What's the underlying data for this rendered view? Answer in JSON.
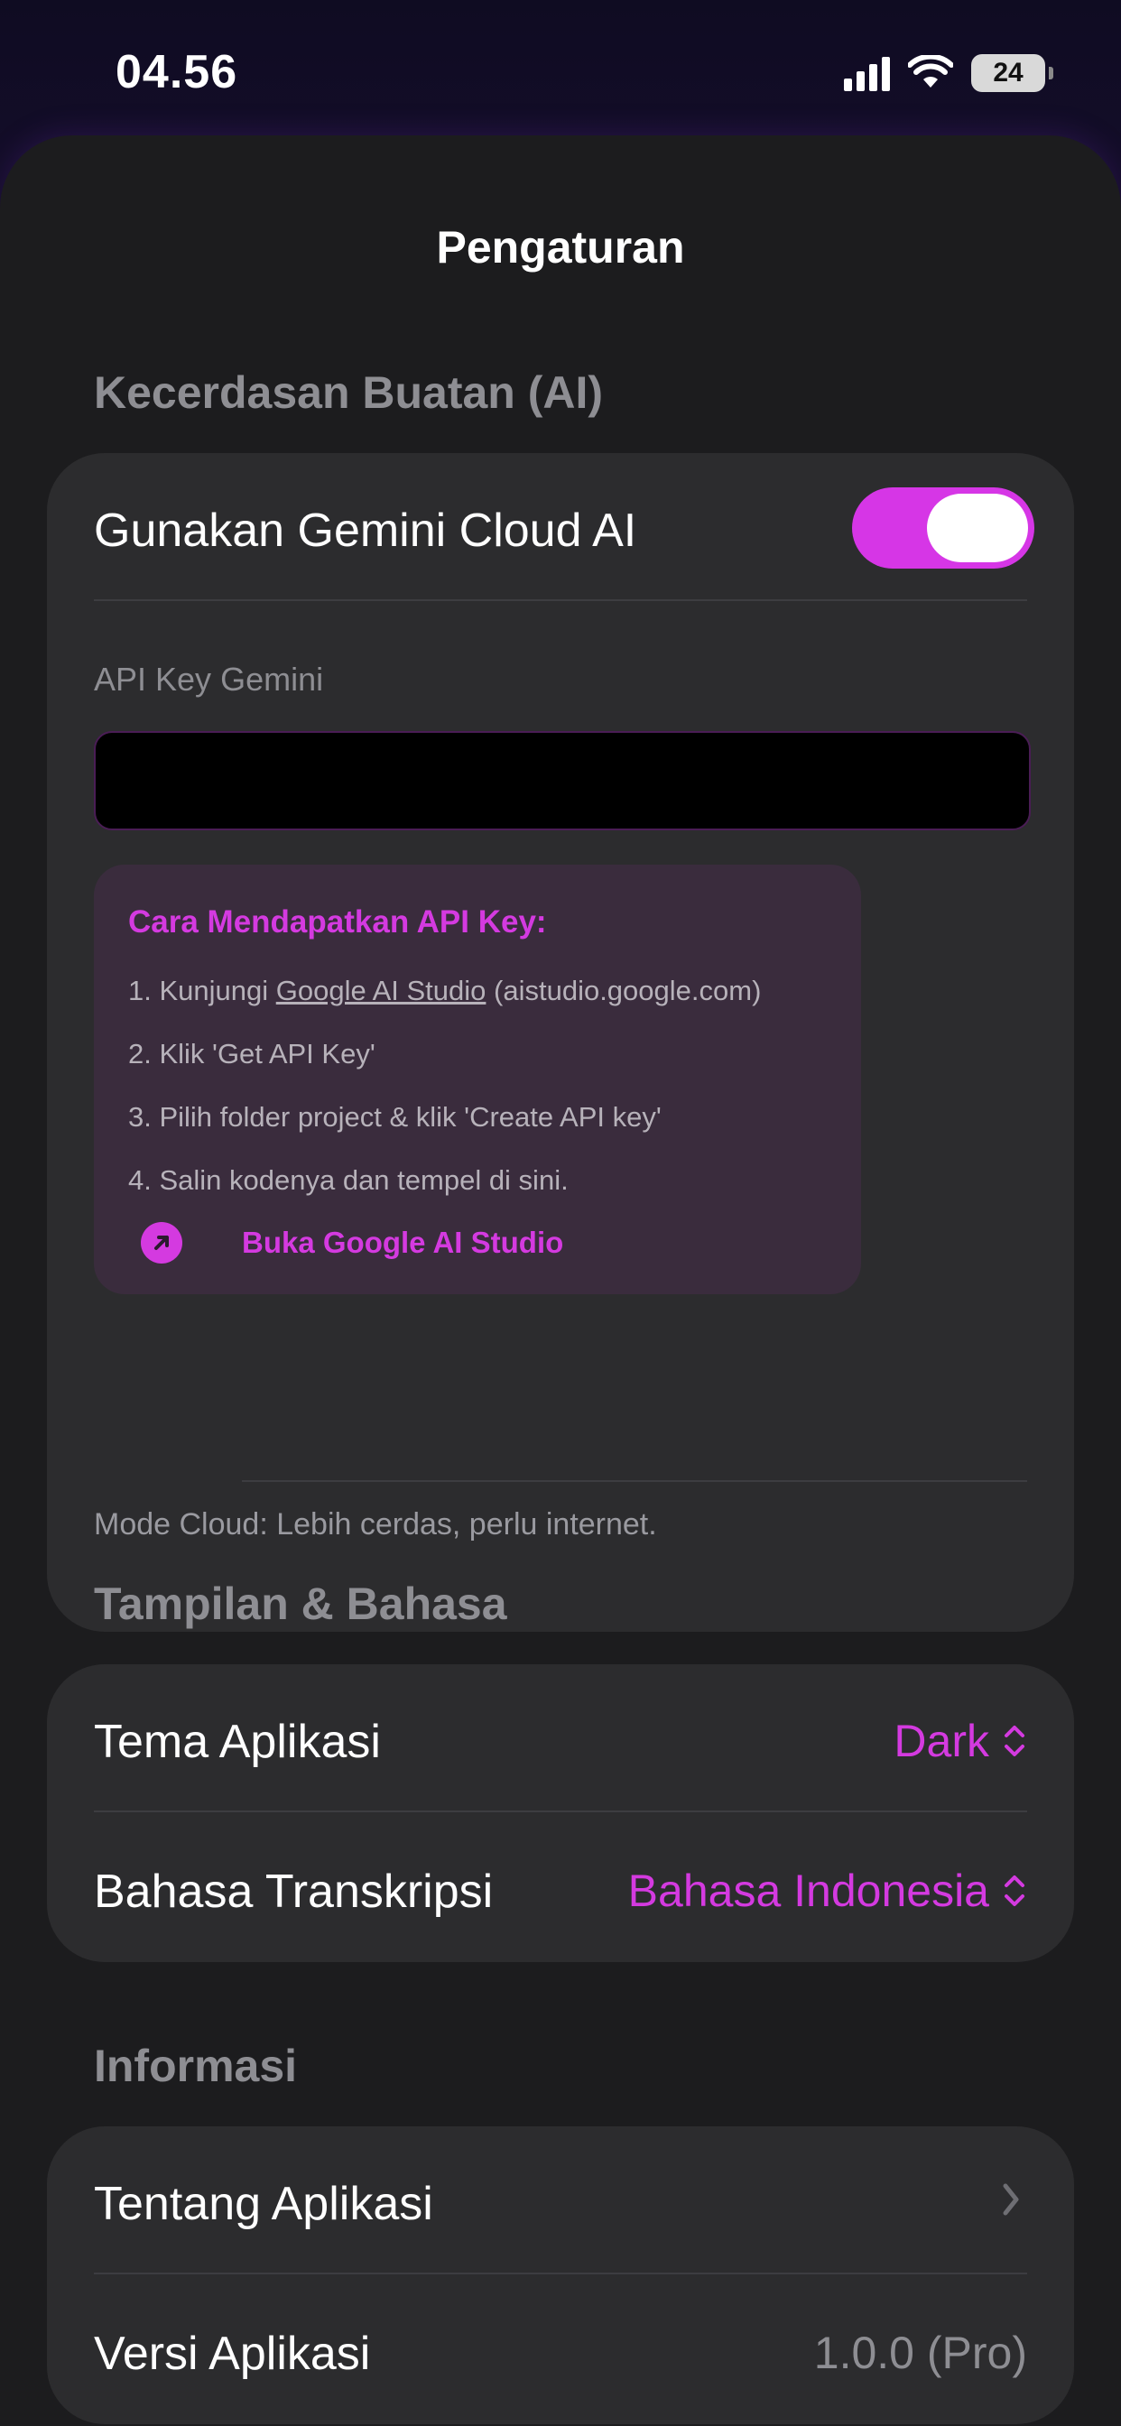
{
  "status_bar": {
    "time": "04.56",
    "battery": "24"
  },
  "title": "Pengaturan",
  "ai_section": {
    "header": "Kecerdasan Buatan (AI)",
    "toggle_label": "Gunakan Gemini Cloud AI",
    "toggle_on": true,
    "api_key_label": "API Key Gemini",
    "api_key_value": "",
    "hint": {
      "title": "Cara Mendapatkan API Key:",
      "step1_prefix": "1. Kunjungi ",
      "step1_link": "Google AI Studio",
      "step1_suffix": " (aistudio.google.com)",
      "step2": "2. Klik 'Get API Key'",
      "step3": "3. Pilih folder project & klik 'Create API key'",
      "step4": "4. Salin kodenya dan tempel di sini.",
      "link_label": "Buka Google AI Studio"
    },
    "mode_note": "Mode Cloud: Lebih cerdas, perlu internet."
  },
  "display_section": {
    "header": "Tampilan & Bahasa",
    "theme_label": "Tema Aplikasi",
    "theme_value": "Dark",
    "language_label": "Bahasa Transkripsi",
    "language_value": "Bahasa Indonesia"
  },
  "info_section": {
    "header": "Informasi",
    "about_label": "Tentang Aplikasi",
    "version_label": "Versi Aplikasi",
    "version_value": "1.0.0 (Pro)"
  },
  "colors": {
    "accent": "#d636e6",
    "card": "#2c2c2e",
    "sheet": "#1c1c1e"
  }
}
